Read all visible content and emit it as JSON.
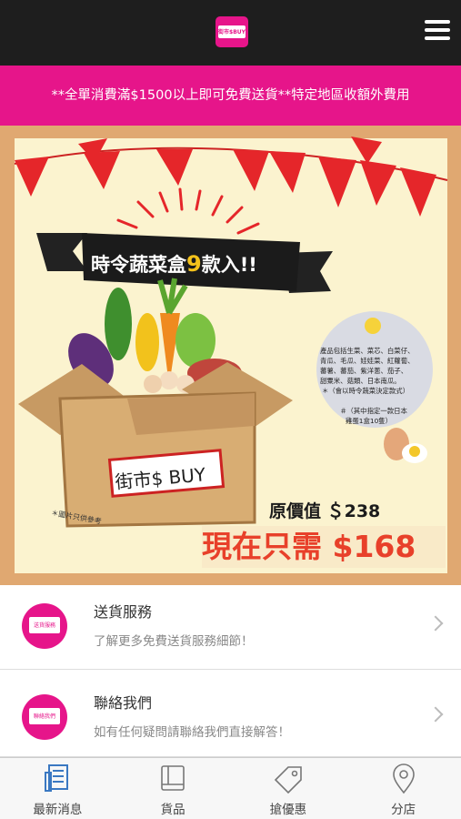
{
  "header": {
    "logo_text": "街市$BUY"
  },
  "promo": {
    "text": "**全單消費滿$1500以上即可免費送貨**特定地區收額外費用"
  },
  "banner": {
    "headline_prefix": "時令蔬菜盒",
    "headline_number": "9",
    "headline_suffix": "款入!!",
    "bubble_lines": [
      "產品包括生菜、菜芯、白菜仔、",
      "青瓜、毛瓜、娃娃菜、紅蘿蔔、",
      "蕃薯、蕃茄、紫洋蔥、茄子、",
      "甜粟米、菇類、日本南瓜。",
      "＊（會以時令蔬菜決定款式）"
    ],
    "bubble_note_lines": [
      "＃（其中指定一款日本",
      "雞蛋1盒10隻）"
    ],
    "box_label": "街市$ BUY",
    "disclaimer": "＊圖片只供參考",
    "original_price": "原價值 ＄238",
    "now_price": "現在只需 $168"
  },
  "list": [
    {
      "icon_text": "送貨服務",
      "title": "送貨服務",
      "subtitle": "了解更多免費送貨服務細節！"
    },
    {
      "icon_text": "聯絡我們",
      "title": "聯絡我們",
      "subtitle": "如有任何疑問請聯絡我們直接解答！"
    }
  ],
  "tabs": [
    {
      "label": "最新消息",
      "icon": "news-icon",
      "active": true
    },
    {
      "label": "貨品",
      "icon": "book-icon"
    },
    {
      "label": "搶優惠",
      "icon": "tag-icon"
    },
    {
      "label": "分店",
      "icon": "location-pin-icon"
    }
  ],
  "colors": {
    "brand": "#e6158a",
    "topbar": "#1e1e1e",
    "price_red": "#e8402a"
  }
}
